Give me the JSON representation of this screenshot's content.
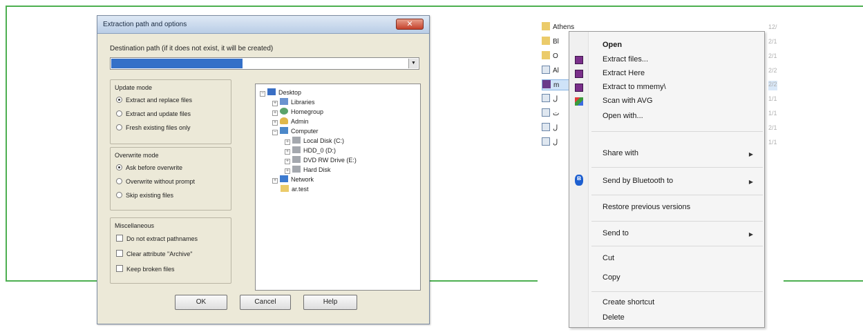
{
  "colors": {
    "frame_green": "#4caf50",
    "selection_blue": "#3470c8"
  },
  "dialog": {
    "title": "Extraction path and options",
    "close_icon": "close-icon",
    "destination_label": "Destination path (if it does not exist, it will be created)",
    "update_mode": {
      "title": "Update mode",
      "options": [
        "Extract and replace files",
        "Extract and update files",
        "Fresh existing files only"
      ],
      "selected": 0
    },
    "overwrite_mode": {
      "title": "Overwrite mode",
      "options": [
        "Ask before overwrite",
        "Overwrite without prompt",
        "Skip existing files"
      ],
      "selected": 0
    },
    "misc": {
      "title": "Miscellaneous",
      "options": [
        "Do not extract pathnames",
        "Clear attribute \"Archive\"",
        "Keep broken files"
      ]
    },
    "tree": [
      {
        "label": "Desktop",
        "icon": "desktop-icon"
      },
      {
        "label": "Libraries",
        "icon": "library-icon"
      },
      {
        "label": "Homegroup",
        "icon": "homegroup-icon"
      },
      {
        "label": "Admin",
        "icon": "user-icon"
      },
      {
        "label": "Computer",
        "icon": "computer-icon"
      },
      {
        "label": "Local Disk (C:)",
        "icon": "disk-icon"
      },
      {
        "label": "HDD_0 (D:)",
        "icon": "disk-icon"
      },
      {
        "label": "DVD RW Drive (E:)",
        "icon": "dvd-icon"
      },
      {
        "label": "Hard Disk",
        "icon": "disk-icon"
      },
      {
        "label": "Network",
        "icon": "network-icon"
      },
      {
        "label": "ar.test",
        "icon": "folder-icon"
      }
    ],
    "buttons": {
      "ok": "OK",
      "cancel": "Cancel",
      "help": "Help"
    }
  },
  "explorer": {
    "files": [
      {
        "label": "Athens",
        "icon": "folder-icon"
      },
      {
        "label": "Bl",
        "icon": "folder-icon"
      },
      {
        "label": "O",
        "icon": "folder-icon"
      },
      {
        "label": "Al",
        "icon": "document-icon"
      },
      {
        "label": "m",
        "icon": "rar-archive-icon"
      },
      {
        "label": "ل",
        "icon": "document-icon"
      },
      {
        "label": "ت",
        "icon": "document-icon"
      },
      {
        "label": "ل",
        "icon": "document-icon"
      },
      {
        "label": "ل",
        "icon": "document-icon"
      }
    ],
    "date_col": [
      "12/",
      "2/1",
      "2/1",
      "2/2",
      "2/2",
      "1/1",
      "1/1",
      "2/1",
      "1/1"
    ]
  },
  "context_menu": {
    "items": [
      {
        "label": "Open",
        "bold": true
      },
      {
        "label": "Extract files...",
        "icon": "winrar-icon"
      },
      {
        "label": "Extract Here",
        "icon": "winrar-icon"
      },
      {
        "label": "Extract to mmemy\\",
        "icon": "winrar-icon"
      },
      {
        "label": "Scan with AVG",
        "icon": "avg-icon"
      },
      {
        "label": "Open with..."
      },
      {
        "label": "Share with",
        "submenu": true
      },
      {
        "label": "Send by Bluetooth to",
        "icon": "bluetooth-icon",
        "submenu": true
      },
      {
        "label": "Restore previous versions"
      },
      {
        "label": "Send to",
        "submenu": true
      },
      {
        "label": "Cut"
      },
      {
        "label": "Copy"
      },
      {
        "label": "Create shortcut"
      },
      {
        "label": "Delete"
      }
    ]
  }
}
